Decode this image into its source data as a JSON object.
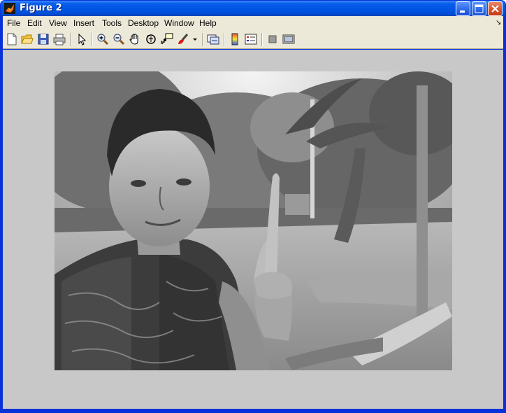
{
  "window": {
    "title": "Figure 2",
    "colors": {
      "titlebar": "#0055e5",
      "menubar": "#ece9d8",
      "canvas": "#c8c8c8"
    }
  },
  "menu": [
    "File",
    "Edit",
    "View",
    "Insert",
    "Tools",
    "Desktop",
    "Window",
    "Help"
  ],
  "menu_right_icon": "↘",
  "toolbar_icons": [
    "new-figure-icon",
    "open-file-icon",
    "save-icon",
    "print-icon",
    "edit-plot-arrow-icon",
    "zoom-in-icon",
    "zoom-out-icon",
    "pan-hand-icon",
    "rotate-3d-icon",
    "data-cursor-icon",
    "brush-icon",
    "brush-dropdown-icon",
    "link-plot-icon",
    "insert-colorbar-icon",
    "insert-legend-icon",
    "hide-plot-tools-icon",
    "show-plot-tools-icon"
  ],
  "image_content": "grayscale photo: young man in batik shirt making a peace sign in front of trees in a park"
}
